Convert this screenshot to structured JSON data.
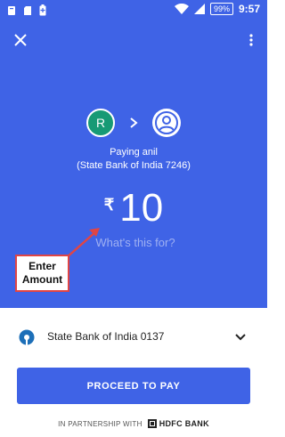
{
  "status_bar": {
    "time": "9:57",
    "battery_percent": "99%",
    "icons": [
      "notification-icon",
      "sd-card-icon",
      "battery-saver-icon",
      "wifi-icon",
      "signal-icon",
      "battery-icon"
    ]
  },
  "header": {
    "close_icon": "close-icon",
    "more_icon": "more-vert-icon"
  },
  "payment": {
    "sender_initial": "R",
    "payee_icon": "person-icon",
    "paying_label": "Paying anil",
    "bank_label": "(State Bank of India 7246)",
    "currency_symbol": "₹",
    "amount": "10",
    "note_placeholder": "What's this for?"
  },
  "annotation": {
    "line1": "Enter",
    "line2": "Amount",
    "color": "#e04545"
  },
  "source_account": {
    "bank_name": "State Bank of India 0137",
    "logo": "sbi-logo-icon"
  },
  "actions": {
    "proceed_label": "PROCEED TO PAY"
  },
  "footer": {
    "partnership_text": "IN PARTNERSHIP WITH",
    "partner_name": "HDFC BANK"
  },
  "colors": {
    "brand_blue": "#3f63e6",
    "avatar_green": "#179a75"
  }
}
